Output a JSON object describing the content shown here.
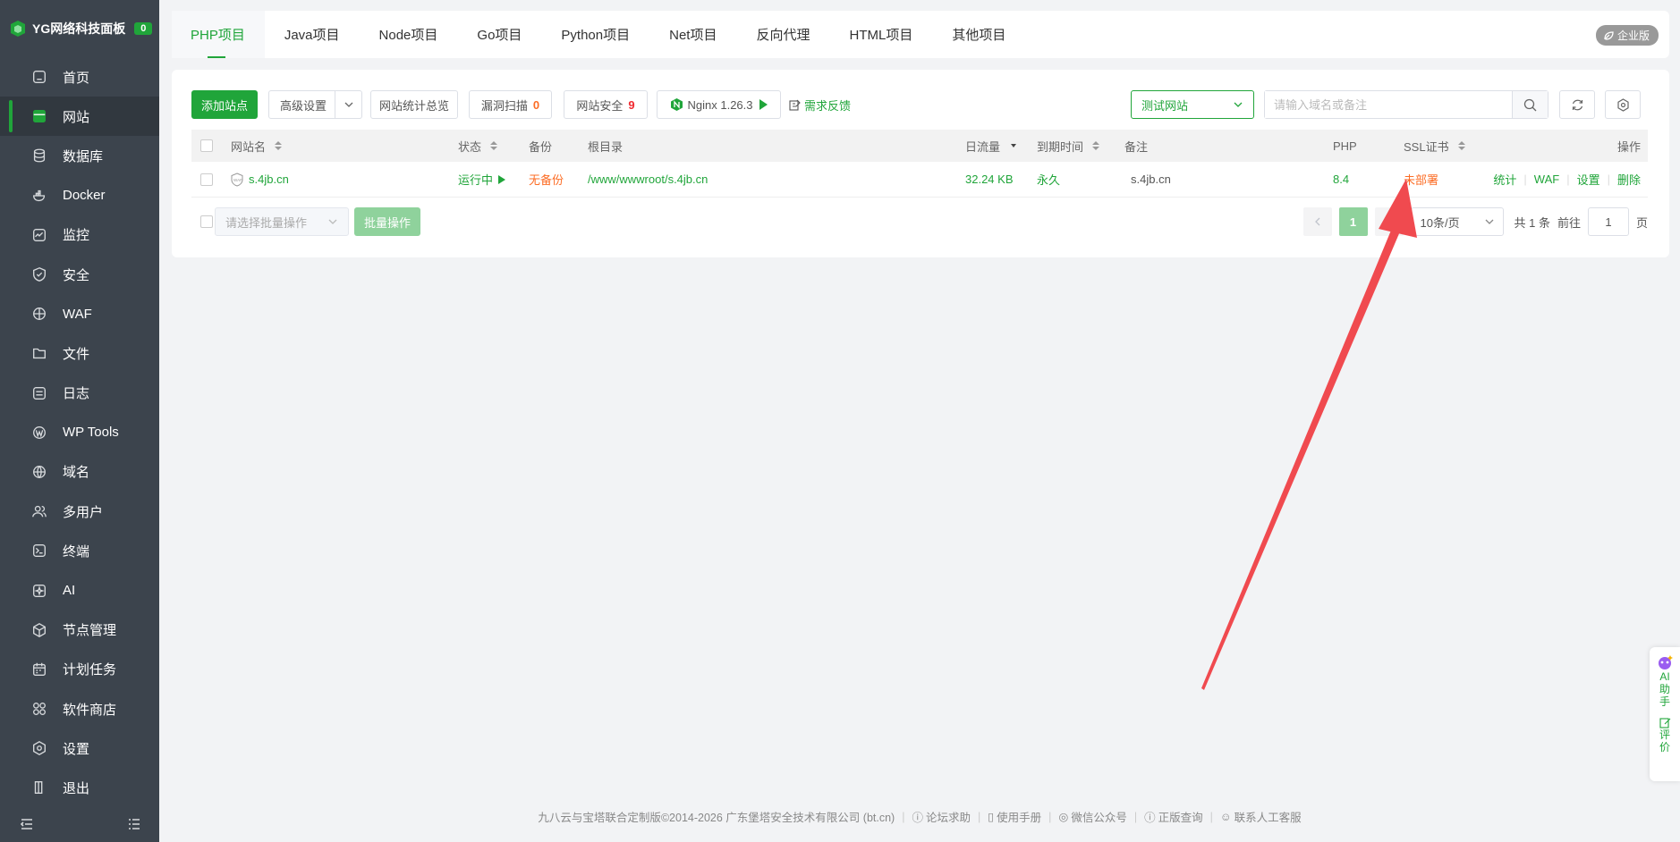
{
  "brand": {
    "name": "YG网络科技面板",
    "badge": "0"
  },
  "sidebar": {
    "items": [
      {
        "label": "首页",
        "icon": "home-icon"
      },
      {
        "label": "网站",
        "icon": "website-icon",
        "active": true
      },
      {
        "label": "数据库",
        "icon": "database-icon"
      },
      {
        "label": "Docker",
        "icon": "docker-icon"
      },
      {
        "label": "监控",
        "icon": "monitor-icon"
      },
      {
        "label": "安全",
        "icon": "shield-icon"
      },
      {
        "label": "WAF",
        "icon": "waf-icon"
      },
      {
        "label": "文件",
        "icon": "folder-icon"
      },
      {
        "label": "日志",
        "icon": "log-icon"
      },
      {
        "label": "WP Tools",
        "icon": "wordpress-icon"
      },
      {
        "label": "域名",
        "icon": "globe-icon"
      },
      {
        "label": "多用户",
        "icon": "users-icon"
      },
      {
        "label": "终端",
        "icon": "terminal-icon"
      },
      {
        "label": "AI",
        "icon": "ai-icon"
      },
      {
        "label": "节点管理",
        "icon": "node-icon"
      },
      {
        "label": "计划任务",
        "icon": "calendar-icon"
      },
      {
        "label": "软件商店",
        "icon": "apps-icon"
      },
      {
        "label": "设置",
        "icon": "settings-icon"
      },
      {
        "label": "退出",
        "icon": "logout-icon"
      }
    ]
  },
  "tabs": [
    {
      "label": "PHP项目",
      "active": true
    },
    {
      "label": "Java项目"
    },
    {
      "label": "Node项目"
    },
    {
      "label": "Go项目"
    },
    {
      "label": "Python项目"
    },
    {
      "label": "Net项目"
    },
    {
      "label": "反向代理"
    },
    {
      "label": "HTML项目"
    },
    {
      "label": "其他项目"
    }
  ],
  "edition_badge": "企业版",
  "toolbar": {
    "add_site": "添加站点",
    "advanced": "高级设置",
    "stats_overview": "网站统计总览",
    "vuln_scan": "漏洞扫描",
    "vuln_count": "0",
    "site_security": "网站安全",
    "security_count": "9",
    "nginx": "Nginx 1.26.3",
    "feedback": "需求反馈",
    "category_select": "测试网站",
    "search_placeholder": "请输入域名或备注"
  },
  "table": {
    "headers": {
      "name": "网站名",
      "status": "状态",
      "backup": "备份",
      "root": "根目录",
      "traffic": "日流量",
      "expire": "到期时间",
      "remark": "备注",
      "php": "PHP",
      "ssl": "SSL证书",
      "ops": "操作"
    },
    "rows": [
      {
        "name": "s.4jb.cn",
        "status": "运行中",
        "backup": "无备份",
        "root": "/www/wwwroot/s.4jb.cn",
        "traffic": "32.24 KB",
        "expire": "永久",
        "remark": "s.4jb.cn",
        "php": "8.4",
        "ssl": "未部署",
        "ops": [
          "统计",
          "WAF",
          "设置",
          "删除"
        ]
      }
    ]
  },
  "bulk": {
    "select_placeholder": "请选择批量操作",
    "button": "批量操作"
  },
  "pager": {
    "current": "1",
    "page_size": "10条/页",
    "total": "共 1 条",
    "goto_label": "前往",
    "goto_value": "1",
    "page_unit": "页"
  },
  "footer": {
    "copyright": "九八云与宝塔联合定制版©2014-2026 广东堡塔安全技术有限公司 (bt.cn)",
    "links": [
      "论坛求助",
      "使用手册",
      "微信公众号",
      "正版查询",
      "联系人工客服"
    ]
  },
  "ai_helper": {
    "label1": "AI",
    "label2": "助",
    "label3": "手",
    "label4": "评",
    "label5": "价"
  },
  "colors": {
    "accent": "#20a53a",
    "warning": "#fc6d26",
    "danger": "#f0292f",
    "sidebar_bg": "#3c444d",
    "annotation_arrow": "#f04a4f"
  }
}
